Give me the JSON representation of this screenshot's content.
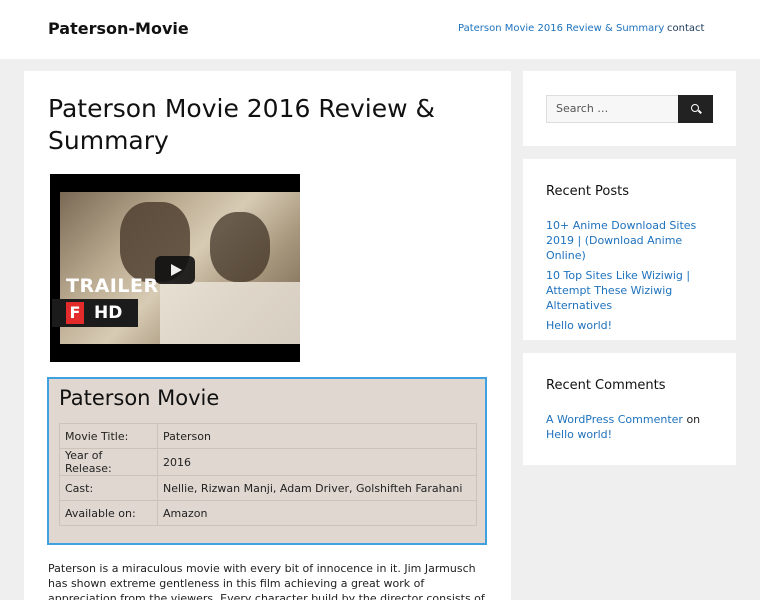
{
  "header": {
    "site_title": "Paterson-Movie",
    "nav": [
      "Paterson Movie 2016 Review & Summary",
      "contact"
    ]
  },
  "post": {
    "title": "Paterson Movie 2016 Review & Summary",
    "video": {
      "overlay_text": "TRAILER",
      "badge_letter": "F",
      "badge_text": "HD"
    },
    "infobox": {
      "title": "Paterson Movie",
      "rows": [
        {
          "key": "Movie Title:",
          "value": "Paterson"
        },
        {
          "key": "Year of Release:",
          "value": "2016"
        },
        {
          "key": "Cast:",
          "value": "Nellie, Rizwan Manji, Adam Driver, Golshifteh Farahani"
        },
        {
          "key": "Available on:",
          "value": "Amazon"
        }
      ]
    },
    "body": "Paterson is a miraculous movie with every bit of innocence in it. Jim Jarmusch has shown extreme gentleness in this film achieving a great work of appreciation from the viewers. Every character build by the director consists of simple innocence which one"
  },
  "sidebar": {
    "search": {
      "placeholder": "Search …",
      "icon": "search-icon"
    },
    "recent_posts": {
      "title": "Recent Posts",
      "items": [
        "10+ Anime Download Sites 2019 | (Download Anime Online)",
        "10 Top Sites Like Wiziwig | Attempt These Wiziwig Alternatives",
        "Hello world!"
      ]
    },
    "recent_comments": {
      "title": "Recent Comments",
      "author": "A WordPress Commenter",
      "connector": "on",
      "post": "Hello world!"
    }
  },
  "colors": {
    "link": "#1e72bd",
    "infobox_border": "#3ea2e0",
    "infobox_bg": "#e0d8d0",
    "page_bg": "#efefef"
  }
}
